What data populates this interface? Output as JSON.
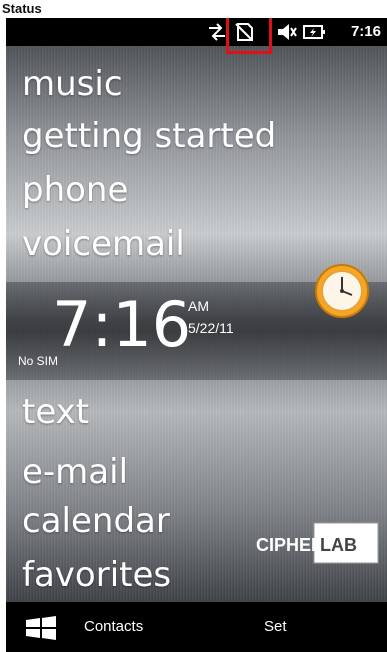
{
  "caption": "Status",
  "status_bar": {
    "time": "7:16",
    "icons": [
      "data-sync-icon",
      "no-sim-icon",
      "speaker-muted-icon",
      "battery-charging-icon"
    ]
  },
  "colors": {
    "highlight": "#e0101a",
    "text": "#ffffff",
    "bar": "#000000"
  },
  "menu": {
    "items": [
      {
        "label": "music"
      },
      {
        "label": "getting started"
      },
      {
        "label": "phone"
      },
      {
        "label": "voicemail"
      },
      {
        "label": "text"
      },
      {
        "label": "e-mail"
      },
      {
        "label": "calendar"
      },
      {
        "label": "favorites"
      }
    ]
  },
  "clock": {
    "time": "7:16",
    "ampm": "AM",
    "date": "5/22/11",
    "sim_status": "No SIM"
  },
  "brand": {
    "text": "CIPHERLAB",
    "icon": "cipherlab-logo"
  },
  "taskbar": {
    "start_icon": "windows-start-icon",
    "left_label": "Contacts",
    "right_label": "Set"
  }
}
